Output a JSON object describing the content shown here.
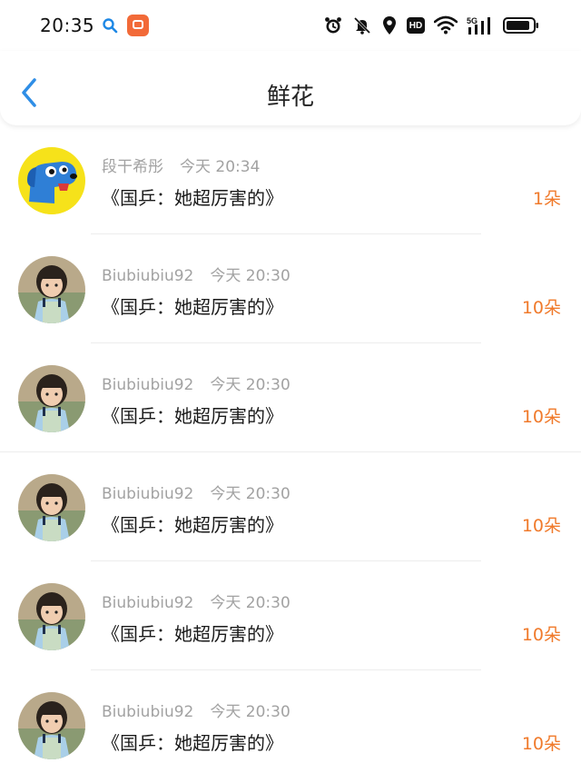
{
  "status_bar": {
    "time": "20:35",
    "hd_label": "HD"
  },
  "header": {
    "title": "鲜花"
  },
  "colors": {
    "accent": "#2f8ee6",
    "flower_count": "#f07a2b",
    "meta_text": "#a2a2a2"
  },
  "items": [
    {
      "user": "段干希彤",
      "time": "今天 20:34",
      "title": "《国乒：她超厉害的》",
      "count": "1朵",
      "avatar": "cartoon-dog"
    },
    {
      "user": "Biubiubiu92",
      "time": "今天 20:30",
      "title": "《国乒：她超厉害的》",
      "count": "10朵",
      "avatar": "child-photo"
    },
    {
      "user": "Biubiubiu92",
      "time": "今天 20:30",
      "title": "《国乒：她超厉害的》",
      "count": "10朵",
      "avatar": "child-photo"
    },
    {
      "user": "Biubiubiu92",
      "time": "今天 20:30",
      "title": "《国乒：她超厉害的》",
      "count": "10朵",
      "avatar": "child-photo"
    },
    {
      "user": "Biubiubiu92",
      "time": "今天 20:30",
      "title": "《国乒：她超厉害的》",
      "count": "10朵",
      "avatar": "child-photo"
    },
    {
      "user": "Biubiubiu92",
      "time": "今天 20:30",
      "title": "《国乒：她超厉害的》",
      "count": "10朵",
      "avatar": "child-photo"
    }
  ]
}
